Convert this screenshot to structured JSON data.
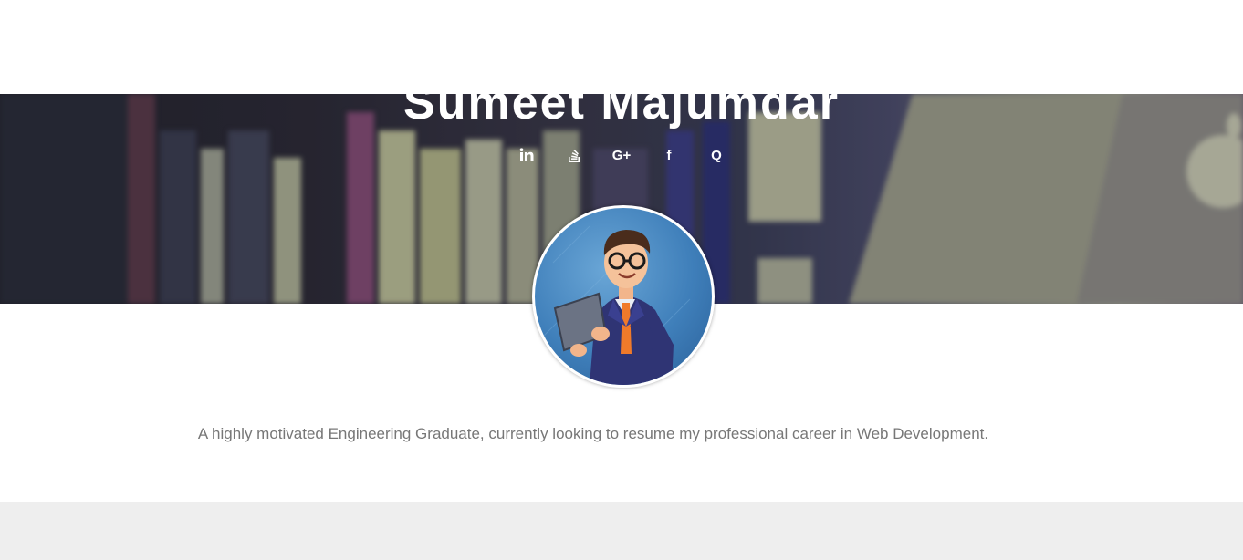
{
  "profile": {
    "name": "Sumeet Majumdar",
    "bio": "A highly motivated Engineering Graduate, currently looking to resume my professional career in Web Development."
  },
  "social": {
    "items": [
      {
        "icon": "linkedin-icon",
        "label": "in"
      },
      {
        "icon": "stackoverflow-icon",
        "label": ""
      },
      {
        "icon": "google-plus-icon",
        "label": "G+"
      },
      {
        "icon": "facebook-icon",
        "label": "f"
      },
      {
        "icon": "quora-icon",
        "label": "Q"
      }
    ]
  },
  "avatar": {
    "icon": "avatar-illustration"
  },
  "colors": {
    "bio_text": "#777777",
    "name_text": "#ffffff",
    "footer_band": "#eeeeee"
  }
}
